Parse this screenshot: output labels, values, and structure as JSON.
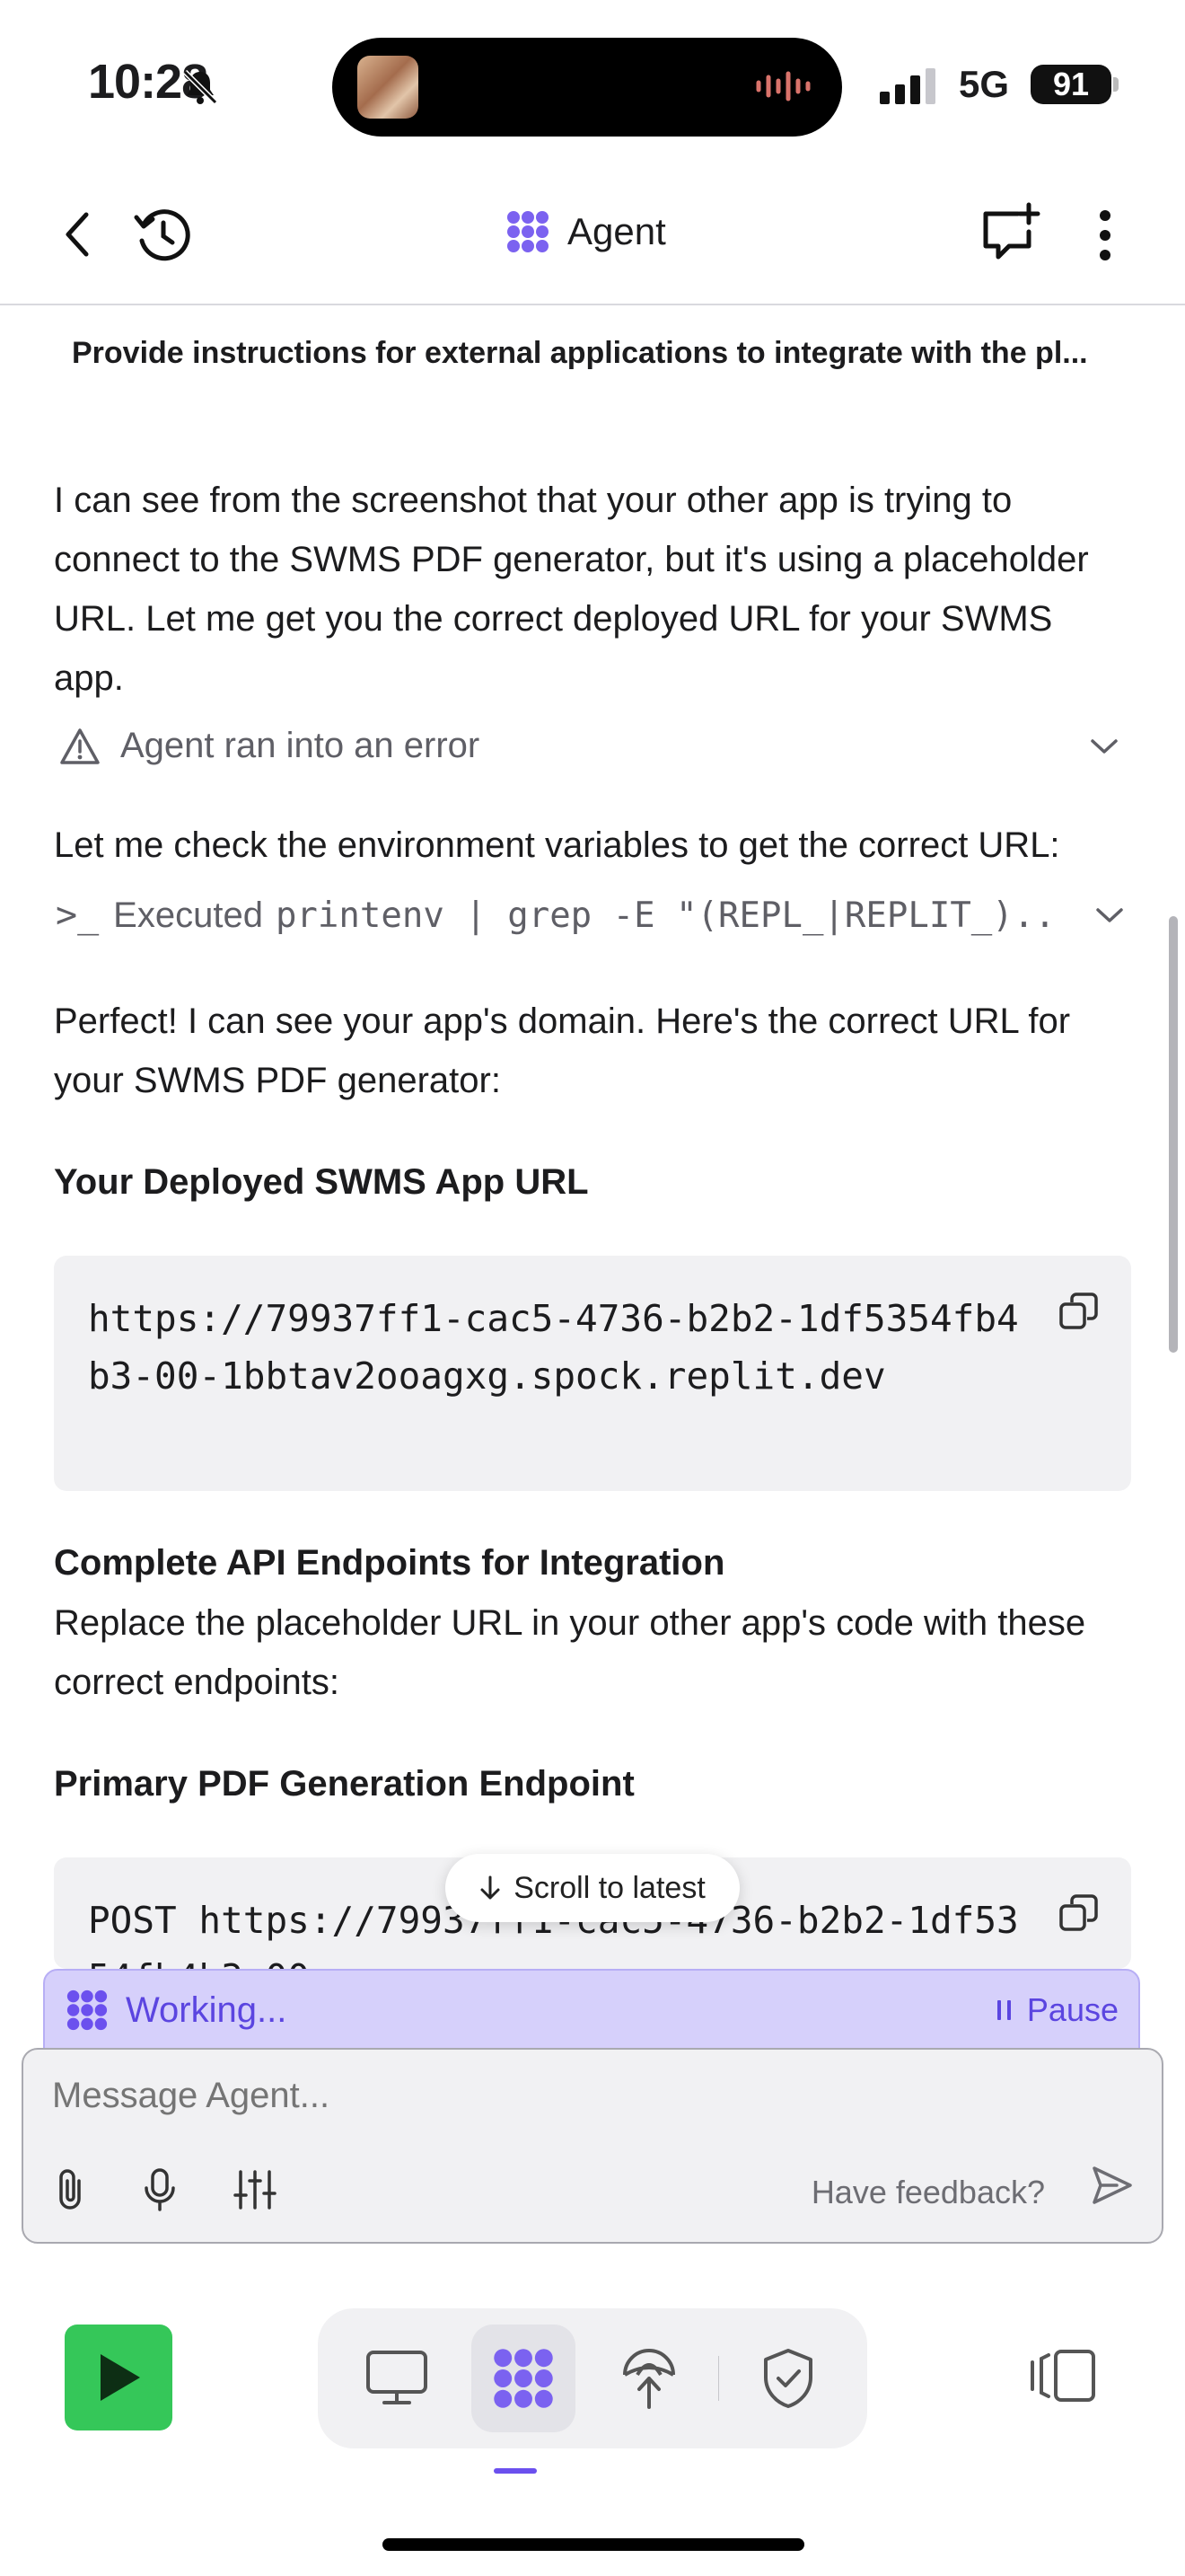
{
  "status": {
    "time": "10:28",
    "network": "5G",
    "battery": "91"
  },
  "header": {
    "title": "Agent",
    "subtitle": "Provide instructions for external applications to integrate with the pl..."
  },
  "chat": {
    "intro": "I can see from the screenshot that your other app is trying to connect to the SWMS PDF generator, but it's using a placeholder URL. Let me get you the correct deployed URL for your SWMS app.",
    "error_label": "Agent ran into an error",
    "check_env": "Let me check the environment variables to get the correct URL:",
    "exec_prefix": "Executed",
    "exec_command": "printenv | grep -E \"(REPL_|REPLIT_)...",
    "perfect": "Perfect! I can see your app's domain. Here's the correct URL for your SWMS PDF generator:",
    "deployed_heading": "Your Deployed SWMS App URL",
    "deployed_url": "https://79937ff1-cac5-4736-b2b2-1df5354fb4b3-00-1bbtav2ooagxg.spock.replit.dev",
    "endpoints_heading": "Complete API Endpoints for Integration",
    "endpoints_text": "Replace the placeholder URL in your other app's code with these correct endpoints:",
    "primary_heading": "Primary PDF Generation Endpoint",
    "primary_code": "POST https://79937ff1-cac5-4736-b2b2-1df5354fb4b3-00"
  },
  "scroll_pill": "Scroll to latest",
  "working": {
    "label": "Working...",
    "pause": "Pause"
  },
  "composer": {
    "placeholder": "Message Agent...",
    "feedback": "Have feedback?"
  },
  "colors": {
    "accent": "#6b50ee",
    "run": "#35c759",
    "working_bg": "#d6d0fb"
  }
}
